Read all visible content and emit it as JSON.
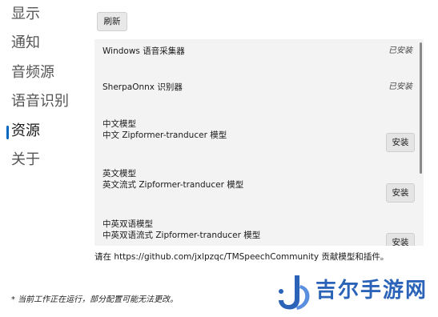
{
  "nav": {
    "items": [
      {
        "label": "显示"
      },
      {
        "label": "通知"
      },
      {
        "label": "音频源"
      },
      {
        "label": "语音识别"
      },
      {
        "label": "资源"
      },
      {
        "label": "关于"
      }
    ],
    "active_index": 4
  },
  "toolbar": {
    "refresh_label": "刷新"
  },
  "resources": {
    "rows": [
      {
        "title": "Windows 语音采集器",
        "status": "已安装"
      },
      {
        "title": "SherpaOnnx 识别器",
        "status": "已安装"
      },
      {
        "title": "中文模型",
        "subtitle": "中文 Zipformer-tranducer 模型",
        "button": "安装"
      },
      {
        "title": "英文模型",
        "subtitle": "英文流式 Zipformer-tranducer 模型",
        "button": "安装"
      },
      {
        "title": "中英双语模型",
        "subtitle": "中英双语流式 Zipformer-tranducer 模型",
        "button": "安装"
      }
    ]
  },
  "hint": "请在 https://github.com/jxlpzqc/TMSpeechCommunity 贡献模型和插件。",
  "footer_note": "* 当前工作正在运行，部分配置可能无法更改。",
  "watermark": {
    "text": "吉尔手游网"
  },
  "colors": {
    "accent": "#0067c0",
    "panel_bg": "#f3f3f3",
    "watermark": "#2b63b8"
  }
}
